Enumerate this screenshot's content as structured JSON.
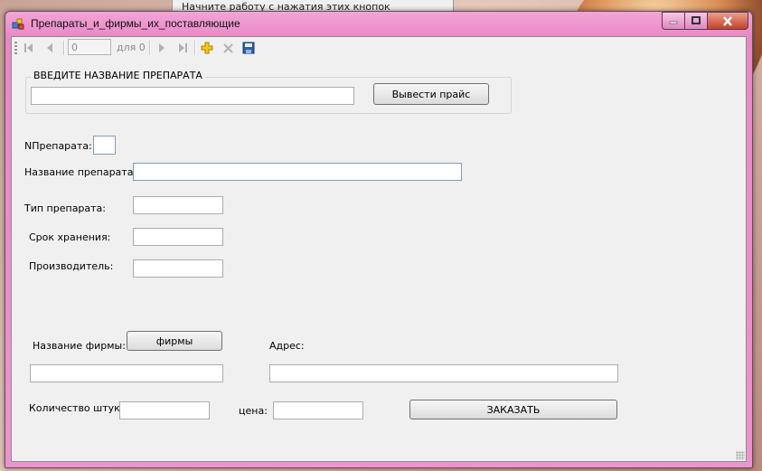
{
  "background": {
    "window_text": "Начните работу с нажатия этих кнопок"
  },
  "window": {
    "title": "Препараты_и_фирмы_их_поставляющие"
  },
  "toolbar": {
    "position_value": "0",
    "count_text": "для 0",
    "icons": [
      "move-first-icon",
      "move-previous-icon",
      "move-next-icon",
      "move-last-icon",
      "add-new-icon",
      "delete-icon",
      "save-icon"
    ]
  },
  "search_group": {
    "title": "ВВЕДИТЕ НАЗВАНИЕ ПРЕПАРАТА",
    "input_value": "",
    "button_label": "Вывести прайс"
  },
  "fields": {
    "n_label": "NПрепарата:",
    "name_label": "Название препарата:",
    "type_label": "Тип препарата:",
    "shelf_label": "Срок хранения:",
    "maker_label": "Производитель:",
    "firm_label": "Название фирмы:",
    "firms_button": "фирмы",
    "address_label": "Адрес:",
    "qty_label": "Количество штук:",
    "price_label": "цена:",
    "order_button": "ЗАКАЗАТЬ"
  },
  "colors": {
    "title_bar": "#e889c6",
    "client_bg": "#f0f0f0",
    "close_button": "#c4412a"
  }
}
